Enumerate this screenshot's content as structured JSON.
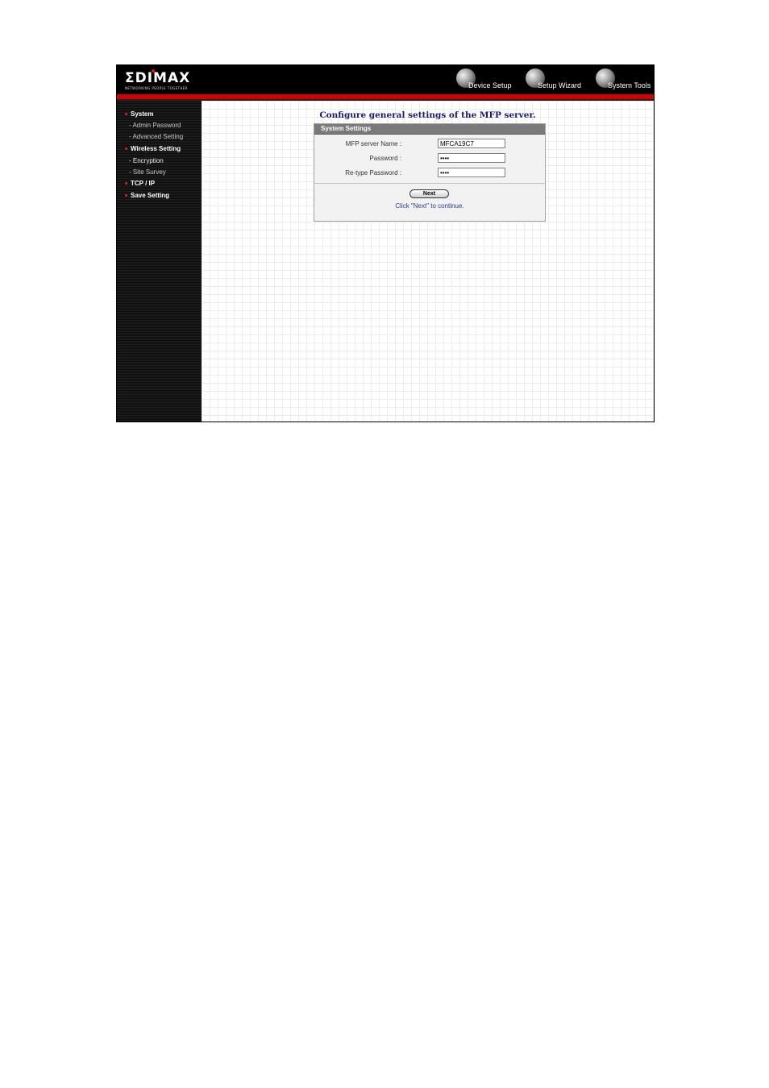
{
  "brand": {
    "logo_text": "ΣDIMAX",
    "tagline": "NETWORKING PEOPLE TOGETHER"
  },
  "top_nav": [
    {
      "label": "Device Setup",
      "icon": "globe-icon"
    },
    {
      "label": "Setup Wizard",
      "icon": "globe-icon"
    },
    {
      "label": "System Tools",
      "icon": "globe-icon"
    }
  ],
  "sidebar": {
    "items": [
      {
        "label": "System",
        "type": "main"
      },
      {
        "label": "- Admin Password",
        "type": "sub"
      },
      {
        "label": "- Advanced Setting",
        "type": "sub"
      },
      {
        "label": "Wireless Setting",
        "type": "main"
      },
      {
        "label": "- Encryption",
        "type": "sub"
      },
      {
        "label": "- Site Survey",
        "type": "sub"
      },
      {
        "label": "TCP / IP",
        "type": "main"
      },
      {
        "label": "Save Setting",
        "type": "main"
      }
    ]
  },
  "main": {
    "title": "Configure general settings of the MFP server.",
    "panel_title": "System Settings",
    "fields": {
      "server_name": {
        "label": "MFP server Name :",
        "value": "MFCA19C7"
      },
      "password": {
        "label": "Password :",
        "value": "****"
      },
      "retype_password": {
        "label": "Re-type Password :",
        "value": "****"
      }
    },
    "next_label": "Next",
    "hint": "Click \"Next\" to continue."
  },
  "colors": {
    "accent_red": "#d40000",
    "title_navy": "#1a1a6e",
    "panel_header": "#7a7a7a"
  }
}
